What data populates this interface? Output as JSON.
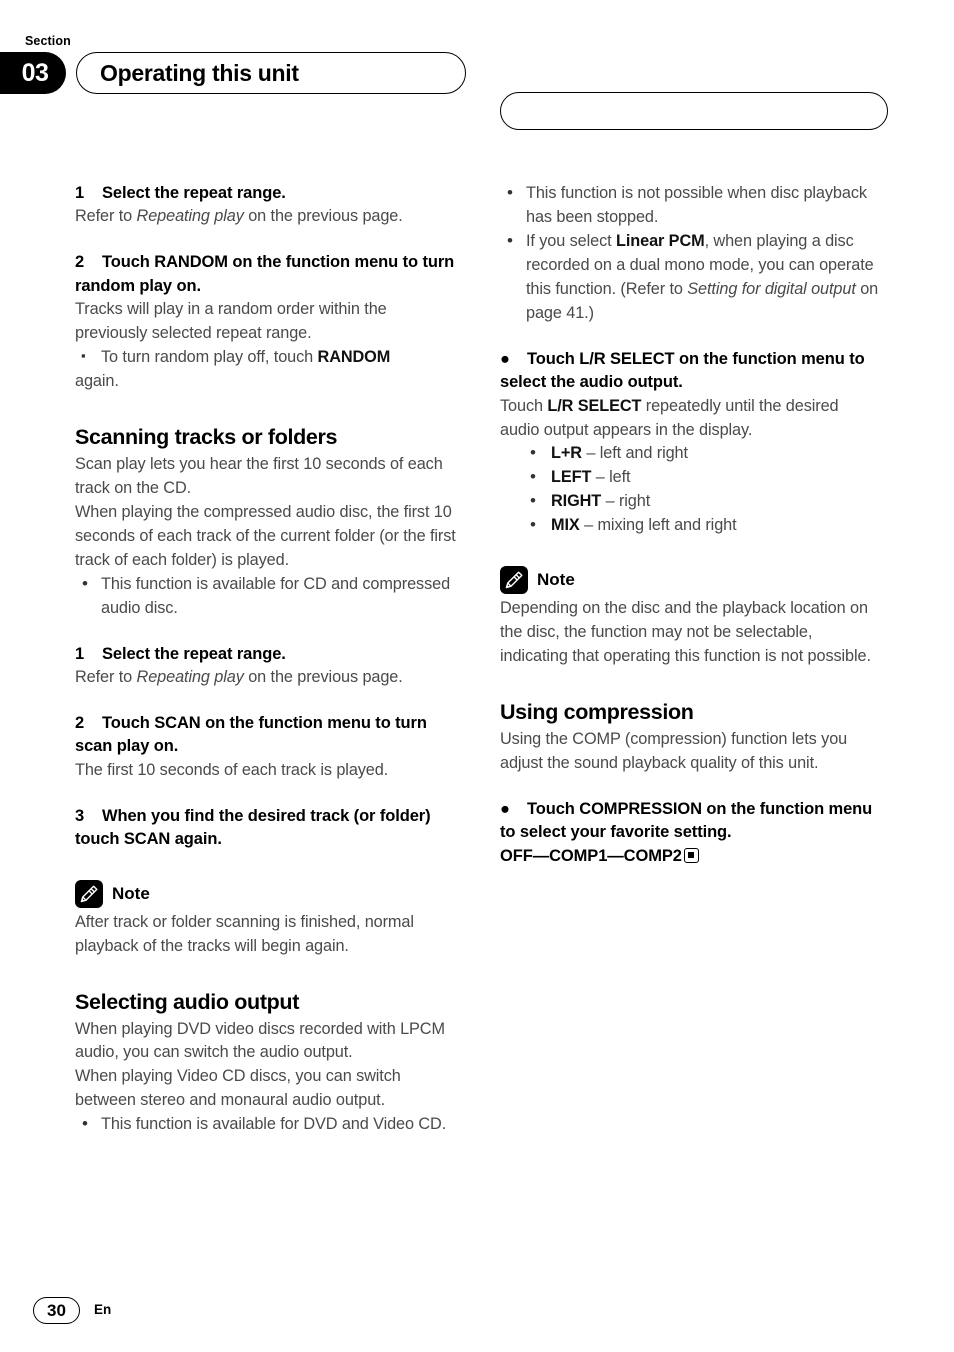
{
  "header": {
    "section_label": "Section",
    "section_number": "03",
    "title": "Operating this unit"
  },
  "left_column": {
    "step_random_1": {
      "num": "1",
      "head": "Select the repeat range.",
      "body_pre": "Refer to ",
      "body_italic": "Repeating play",
      "body_post": " on the previous page."
    },
    "step_random_2": {
      "num": "2",
      "head": "Touch RANDOM on the function menu to turn random play on.",
      "body": "Tracks will play in a random order within the previously selected repeat range.",
      "bullet_pre": "To turn random play off, touch ",
      "bullet_bold": "RANDOM",
      "bullet_post": " again."
    },
    "scanning": {
      "heading": "Scanning tracks or folders",
      "body1": "Scan play lets you hear the first 10 seconds of each track on the CD.",
      "body2": "When playing the compressed audio disc, the first 10 seconds of each track of the current folder (or the first track of each folder) is played.",
      "bullet1": "This function is available for CD and compressed audio disc."
    },
    "step_scan_1": {
      "num": "1",
      "head": "Select the repeat range.",
      "body_pre": "Refer to ",
      "body_italic": "Repeating play",
      "body_post": " on the previous page."
    },
    "step_scan_2": {
      "num": "2",
      "head": "Touch SCAN on the function menu to turn scan play on.",
      "body": "The first 10 seconds of each track is played."
    },
    "step_scan_3": {
      "num": "3",
      "head": "When you find the desired track (or folder) touch SCAN again."
    },
    "note_scan": {
      "label": "Note",
      "body": "After track or folder scanning is finished, normal playback of the tracks will begin again."
    },
    "audio_output": {
      "heading": "Selecting audio output",
      "body1": "When playing DVD video discs recorded with LPCM audio, you can switch the audio output.",
      "body2": "When playing Video CD discs, you can switch between stereo and monaural audio output.",
      "bullet1": "This function is available for DVD and Video CD."
    }
  },
  "right_column": {
    "top_bullets": {
      "b1": "This function is not possible when disc playback has been stopped.",
      "b2_pre": "If you select ",
      "b2_bold": "Linear PCM",
      "b2_mid": ", when playing a disc recorded on a dual mono mode, you can operate this function. (Refer to ",
      "b2_italic": "Setting for digital output",
      "b2_post": " on page 41.)"
    },
    "lr_select": {
      "head": "Touch L/R SELECT on the function menu to select the audio output.",
      "body_pre": "Touch ",
      "body_bold": "L/R SELECT",
      "body_post": " repeatedly until the desired audio output appears in the display.",
      "options": [
        {
          "key": "L+R",
          "desc": " – left and right"
        },
        {
          "key": "LEFT",
          "desc": " – left"
        },
        {
          "key": "RIGHT",
          "desc": " – right"
        },
        {
          "key": "MIX",
          "desc": " – mixing left and right"
        }
      ]
    },
    "note_lr": {
      "label": "Note",
      "body": "Depending on the disc and the playback location on the disc, the function may not be selectable, indicating that operating this function is not possible."
    },
    "compression": {
      "heading": "Using compression",
      "body1": "Using the COMP (compression) function lets you adjust the sound playback quality of this unit.",
      "head": "Touch COMPRESSION on the function menu to select your favorite setting.",
      "settings": "OFF—COMP1—COMP2"
    }
  },
  "footer": {
    "page_number": "30",
    "language": "En"
  }
}
